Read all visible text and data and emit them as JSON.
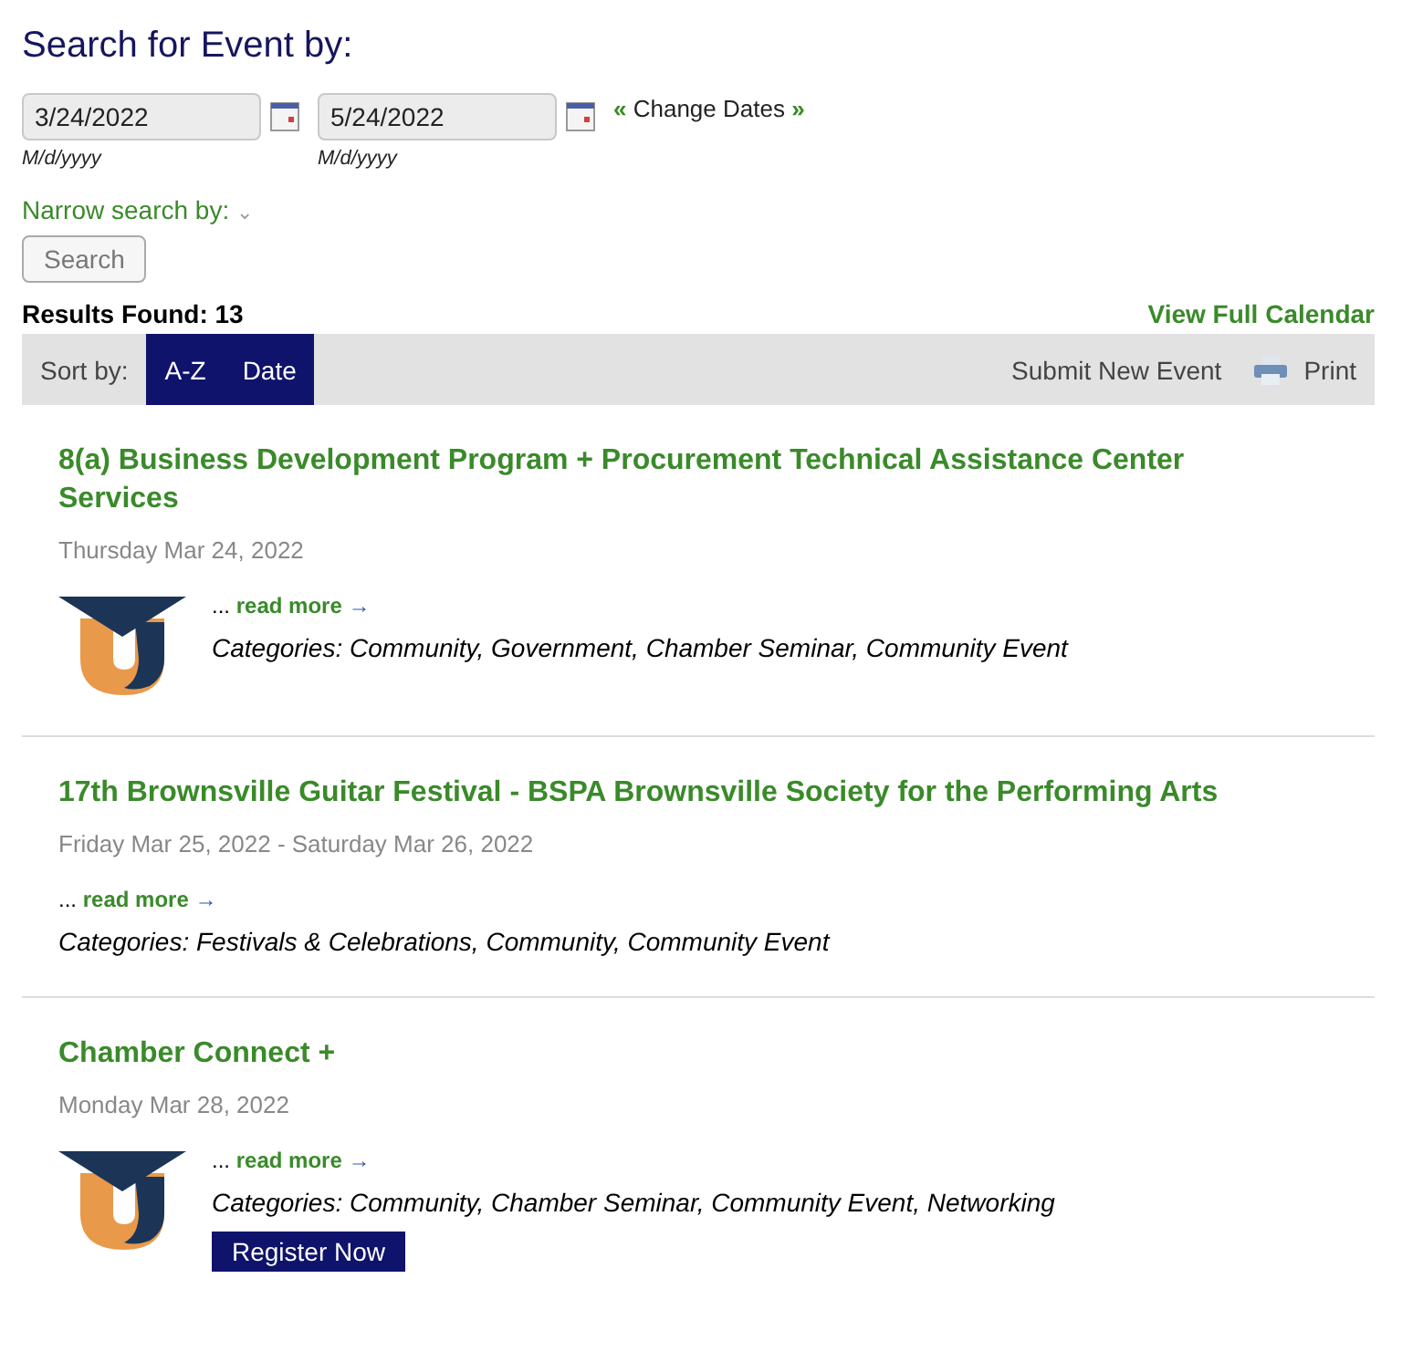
{
  "heading": "Search for Event by:",
  "date_fields": [
    {
      "value": "3/24/2022",
      "format_hint": "M/d/yyyy"
    },
    {
      "value": "5/24/2022",
      "format_hint": "M/d/yyyy"
    }
  ],
  "change_dates": {
    "left": "«",
    "label": "Change Dates",
    "right": "»"
  },
  "narrow_search": {
    "label": "Narrow search by:",
    "caret": "⌄"
  },
  "search_button": "Search",
  "results_found": "Results Found: 13",
  "view_full_calendar": "View Full Calendar",
  "toolbar": {
    "sort_label": "Sort by:",
    "sort_options": [
      "A-Z",
      "Date"
    ],
    "submit": "Submit New Event",
    "print": "Print"
  },
  "events": [
    {
      "title": "8(a) Business Development Program + Procurement Technical Assistance Center Services",
      "date": "Thursday Mar 24, 2022",
      "ellipsis": "...",
      "read_more": "read more",
      "arrow": "→",
      "categories": "Categories: Community, Government, Chamber Seminar, Community Event",
      "has_logo": true
    },
    {
      "title": "17th Brownsville Guitar Festival - BSPA Brownsville Society for the Performing Arts",
      "date": "Friday Mar 25, 2022 - Saturday Mar 26, 2022",
      "ellipsis": "...",
      "read_more": "read more",
      "arrow": "→",
      "categories": "Categories: Festivals & Celebrations, Community, Community Event",
      "has_logo": false
    },
    {
      "title": "Chamber Connect +",
      "date": "Monday Mar 28, 2022",
      "ellipsis": "...",
      "read_more": "read more",
      "arrow": "→",
      "categories": "Categories: Community, Chamber Seminar, Community Event, Networking",
      "has_logo": true,
      "register": "Register Now"
    }
  ]
}
